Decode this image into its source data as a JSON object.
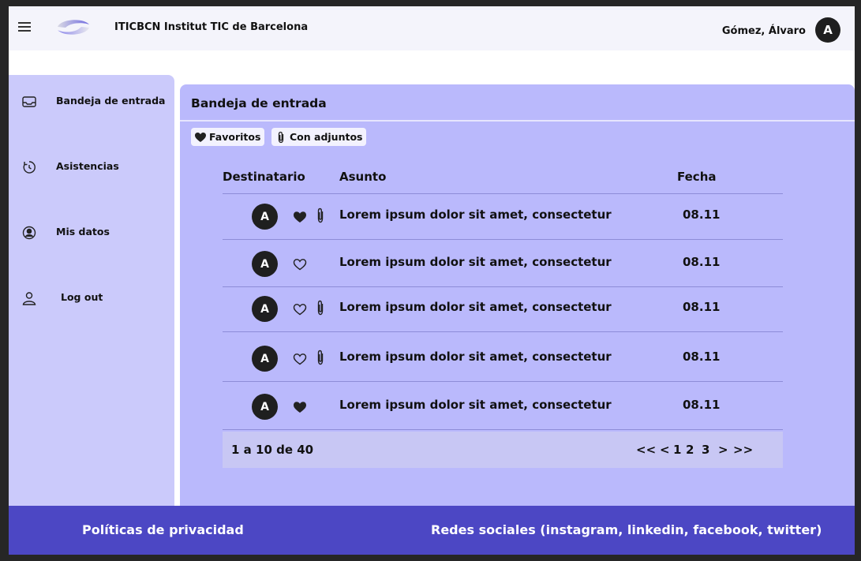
{
  "header": {
    "institution": "ITICBCN Institut TIC de Barcelona",
    "user_name": "Gómez, Álvaro",
    "avatar_letter": "A"
  },
  "sidebar": {
    "items": [
      {
        "label": "Bandeja de entrada",
        "icon": "inbox-icon"
      },
      {
        "label": "Asistencias",
        "icon": "clock-icon"
      },
      {
        "label": "Mis datos",
        "icon": "user-circle-icon"
      },
      {
        "label": "Log out",
        "icon": "user-icon"
      }
    ]
  },
  "main": {
    "title": "Bandeja de entrada",
    "filters": [
      {
        "label": "Favoritos",
        "icon": "heart-icon"
      },
      {
        "label": "Con adjuntos",
        "icon": "paperclip-icon"
      }
    ],
    "columns": [
      "Destinatario",
      "Asunto",
      "Fecha"
    ],
    "rows": [
      {
        "avatar": "A",
        "favorite": true,
        "attachment": true,
        "subject": "Lorem ipsum dolor sit amet, consectetur",
        "date": "08.11"
      },
      {
        "avatar": "A",
        "favorite": false,
        "attachment": false,
        "subject": "Lorem ipsum dolor sit amet, consectetur",
        "date": "08.11"
      },
      {
        "avatar": "A",
        "favorite": false,
        "attachment": true,
        "subject": "Lorem ipsum dolor sit amet, consectetur",
        "date": "08.11"
      },
      {
        "avatar": "A",
        "favorite": false,
        "attachment": true,
        "subject": "Lorem ipsum dolor sit amet, consectetur",
        "date": "08.11"
      },
      {
        "avatar": "A",
        "favorite": true,
        "attachment": false,
        "subject": "Lorem ipsum dolor sit amet, consectetur",
        "date": "08.11"
      }
    ],
    "pagination": {
      "summary": "1 a 10 de 40",
      "first": "<<",
      "prev": "<",
      "pages": [
        "1",
        "2",
        "3"
      ],
      "next": ">",
      "last": ">>"
    }
  },
  "footer": {
    "privacy": "Políticas de privacidad",
    "social": "Redes sociales (instagram, linkedin, facebook, twitter)"
  },
  "colors": {
    "sidebar_bg": "#cbcafb",
    "main_bg": "#bab9fc",
    "footer_bg": "#4c47c4",
    "header_bg": "#f4f4fb"
  }
}
